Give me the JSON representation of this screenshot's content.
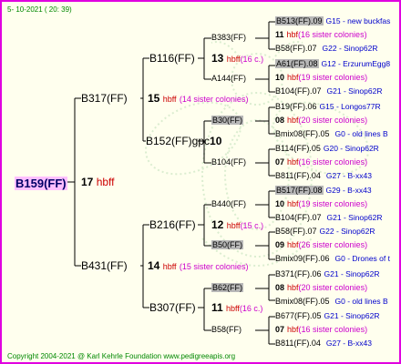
{
  "date": "5- 10-2021 ( 20: 39)",
  "copyright": "Copyright 2004-2021 @ Karl Kehrle Foundation    www.pedigreeapis.org",
  "root": {
    "name": "B159(FF)",
    "count": "17",
    "suffix": "hbff"
  },
  "gen1": [
    {
      "name": "B317(FF)",
      "count": "15",
      "hbf": "hbff",
      "sisters": "(14 sister colonies)"
    },
    {
      "name": "B431(FF)",
      "count": "14",
      "hbf": "hbff",
      "sisters": "(15 sister colonies)"
    }
  ],
  "gen2": [
    {
      "name": "B116(FF)",
      "count": "13",
      "hbf": "hbff",
      "sisters": "(16 c.)"
    },
    {
      "name": "B152(FF)gpc",
      "count": "10",
      "hbf": "",
      "sisters": ""
    },
    {
      "name": "B216(FF)",
      "count": "12",
      "hbf": "hbff",
      "sisters": "(15 c.)"
    },
    {
      "name": "B307(FF)",
      "count": "11",
      "hbf": "hbff",
      "sisters": "(16 c.)"
    }
  ],
  "gen3": [
    {
      "name": "B383(FF)"
    },
    {
      "name": "A144(FF)"
    },
    {
      "name": "B30(FF)"
    },
    {
      "name": "B104(FF)"
    },
    {
      "name": "B440(FF)"
    },
    {
      "name": "B50(FF)"
    },
    {
      "name": "B62(FF)"
    },
    {
      "name": "B58(FF)"
    }
  ],
  "gen4": [
    {
      "top": "B513(FF).09",
      "topInfo": "G15 - new buckfas",
      "count": "11",
      "hbf": "hbf",
      "sisters": "(16 sister colonies)",
      "bottom": "B58(FF).07",
      "bottomInfo": "G22 - Sinop62R"
    },
    {
      "top": "A61(FF).08",
      "topInfo": "G12 - ErzurumEgg8",
      "count": "10",
      "hbf": "hbf",
      "sisters": "(19 sister colonies)",
      "bottom": "B104(FF).07",
      "bottomInfo": "G21 - Sinop62R"
    },
    {
      "top": "B19(FF).06",
      "topInfo": "G15 - Longos77R",
      "count": "08",
      "hbf": "hbf",
      "sisters": "(20 sister colonies)",
      "bottom": "Bmix08(FF).05",
      "bottomInfo": "G0 - old lines B"
    },
    {
      "top": "B114(FF).05",
      "topInfo": "G20 - Sinop62R",
      "count": "07",
      "hbf": "hbf",
      "sisters": "(16 sister colonies)",
      "bottom": "B811(FF).04",
      "bottomInfo": "G27 - B-xx43"
    },
    {
      "top": "B517(FF).08",
      "topInfo": "G29 - B-xx43",
      "count": "10",
      "hbf": "hbf",
      "sisters": "(19 sister colonies)",
      "bottom": "B104(FF).07",
      "bottomInfo": "G21 - Sinop62R"
    },
    {
      "top": "B58(FF).07",
      "topInfo": "G22 - Sinop62R",
      "count": "09",
      "hbf": "hbf",
      "sisters": "(26 sister colonies)",
      "bottom": "Bmix09(FF).06",
      "bottomInfo": "G0 - Drones of t"
    },
    {
      "top": "B371(FF).06",
      "topInfo": "G21 - Sinop62R",
      "count": "08",
      "hbf": "hbf",
      "sisters": "(20 sister colonies)",
      "bottom": "Bmix08(FF).05",
      "bottomInfo": "G0 - old lines B"
    },
    {
      "top": "B677(FF).05",
      "topInfo": "G21 - Sinop62R",
      "count": "07",
      "hbf": "hbf",
      "sisters": "(16 sister colonies)",
      "bottom": "B811(FF).04",
      "bottomInfo": "G27 - B-xx43"
    }
  ],
  "colors": {
    "border": "#e000e0",
    "background": "#ffffee",
    "hbf": "#cc0000",
    "sisters": "#cc00cc",
    "info": "#0000cc",
    "footer": "#008800",
    "highlight": "#b8b8b8",
    "rootHighlight": "#ffbfff"
  }
}
